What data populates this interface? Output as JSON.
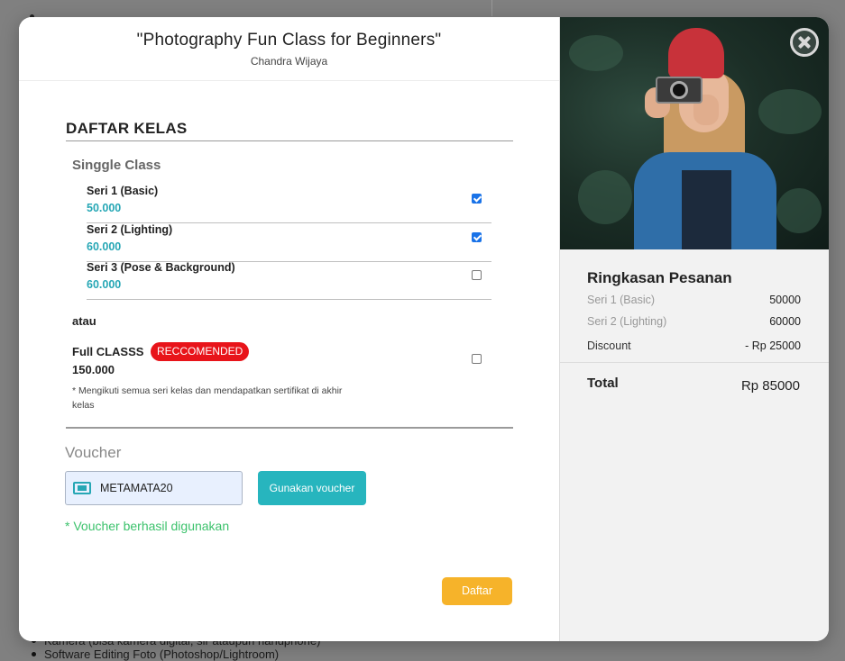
{
  "background": {
    "bullets": [
      "Kamera (bisa kamera digital, slr ataupun handphone)",
      "Software Editing Foto (Photoshop/Lightroom)"
    ]
  },
  "header": {
    "title": "\"Photography Fun Class for Beginners\"",
    "author": "Chandra Wijaya"
  },
  "class_list": {
    "title": "DAFTAR KELAS",
    "single_label": "Singgle Class",
    "items": [
      {
        "name": "Seri 1 (Basic)",
        "price": "50.000",
        "checked": true
      },
      {
        "name": "Seri 2 (Lighting)",
        "price": "60.000",
        "checked": true
      },
      {
        "name": "Seri 3 (Pose & Background)",
        "price": "60.000",
        "checked": false
      }
    ],
    "or_label": "atau",
    "full": {
      "name": "Full CLASSS",
      "badge": "RECCOMENDED",
      "price": "150.000",
      "note": "* Mengikuti semua seri kelas dan mendapatkan sertifikat di akhir kelas",
      "checked": false
    }
  },
  "voucher": {
    "label": "Voucher",
    "value": "METAMATA20",
    "button": "Gunakan voucher",
    "success": "* Voucher berhasil digunakan"
  },
  "submit_label": "Daftar",
  "summary": {
    "title": "Ringkasan Pesanan",
    "lines": [
      {
        "label": "Seri 1 (Basic)",
        "value": "50000"
      },
      {
        "label": "Seri 2 (Lighting)",
        "value": "60000"
      }
    ],
    "discount_label": "Discount",
    "discount_value": "- Rp 25000",
    "total_label": "Total",
    "total_value": "Rp 85000"
  },
  "colors": {
    "accent": "#27a7b5",
    "badge": "#e8141a",
    "submit": "#f6b32a",
    "success": "#3cc26c",
    "checkbox": "#1a73e8"
  },
  "icons": {
    "close": "close-circle-icon",
    "voucher": "ticket-icon"
  }
}
